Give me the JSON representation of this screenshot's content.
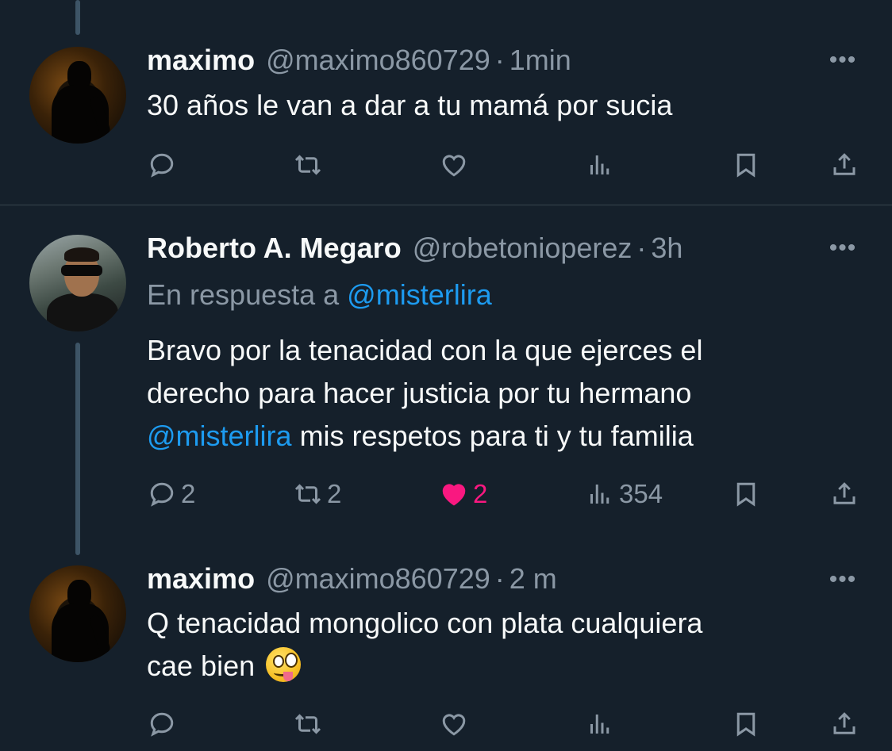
{
  "tweets": [
    {
      "name": "maximo",
      "handle": "@maximo860729",
      "separator": "·",
      "time": "1min",
      "text": "30 años le van a dar a tu mamá por sucia",
      "actions": {
        "reply": "",
        "retweet": "",
        "like": "",
        "views": ""
      }
    },
    {
      "name": "Roberto A. Megaro",
      "handle": "@robetonioperez",
      "separator": "·",
      "time": "3h",
      "reply_prefix": "En respuesta a",
      "reply_mention": "@misterlira",
      "text_line1": "Bravo por la tenacidad con la que ejerces el",
      "text_line2": "derecho para hacer justicia por tu hermano",
      "text_mention": "@misterlira",
      "text_line3_rest": " mis respetos para ti y tu familia",
      "actions": {
        "reply": "2",
        "retweet": "2",
        "like": "2",
        "views": "354"
      }
    },
    {
      "name": "maximo",
      "handle": "@maximo860729",
      "separator": "·",
      "time": "2 m",
      "text_line1": "Q tenacidad mongolico con plata cualquiera",
      "text_line2": "cae bien",
      "actions": {
        "reply": "",
        "retweet": "",
        "like": "",
        "views": ""
      }
    }
  ],
  "more_label": "•••",
  "colors": {
    "background": "#15202b",
    "muted": "#8b98a5",
    "accent": "#1d9bf0",
    "like": "#f91880"
  },
  "icons": [
    "reply-icon",
    "retweet-icon",
    "like-icon",
    "views-icon",
    "bookmark-icon",
    "share-icon",
    "more-icon",
    "face-with-stuck-out-tongue-and-winking-eye-emoji"
  ]
}
